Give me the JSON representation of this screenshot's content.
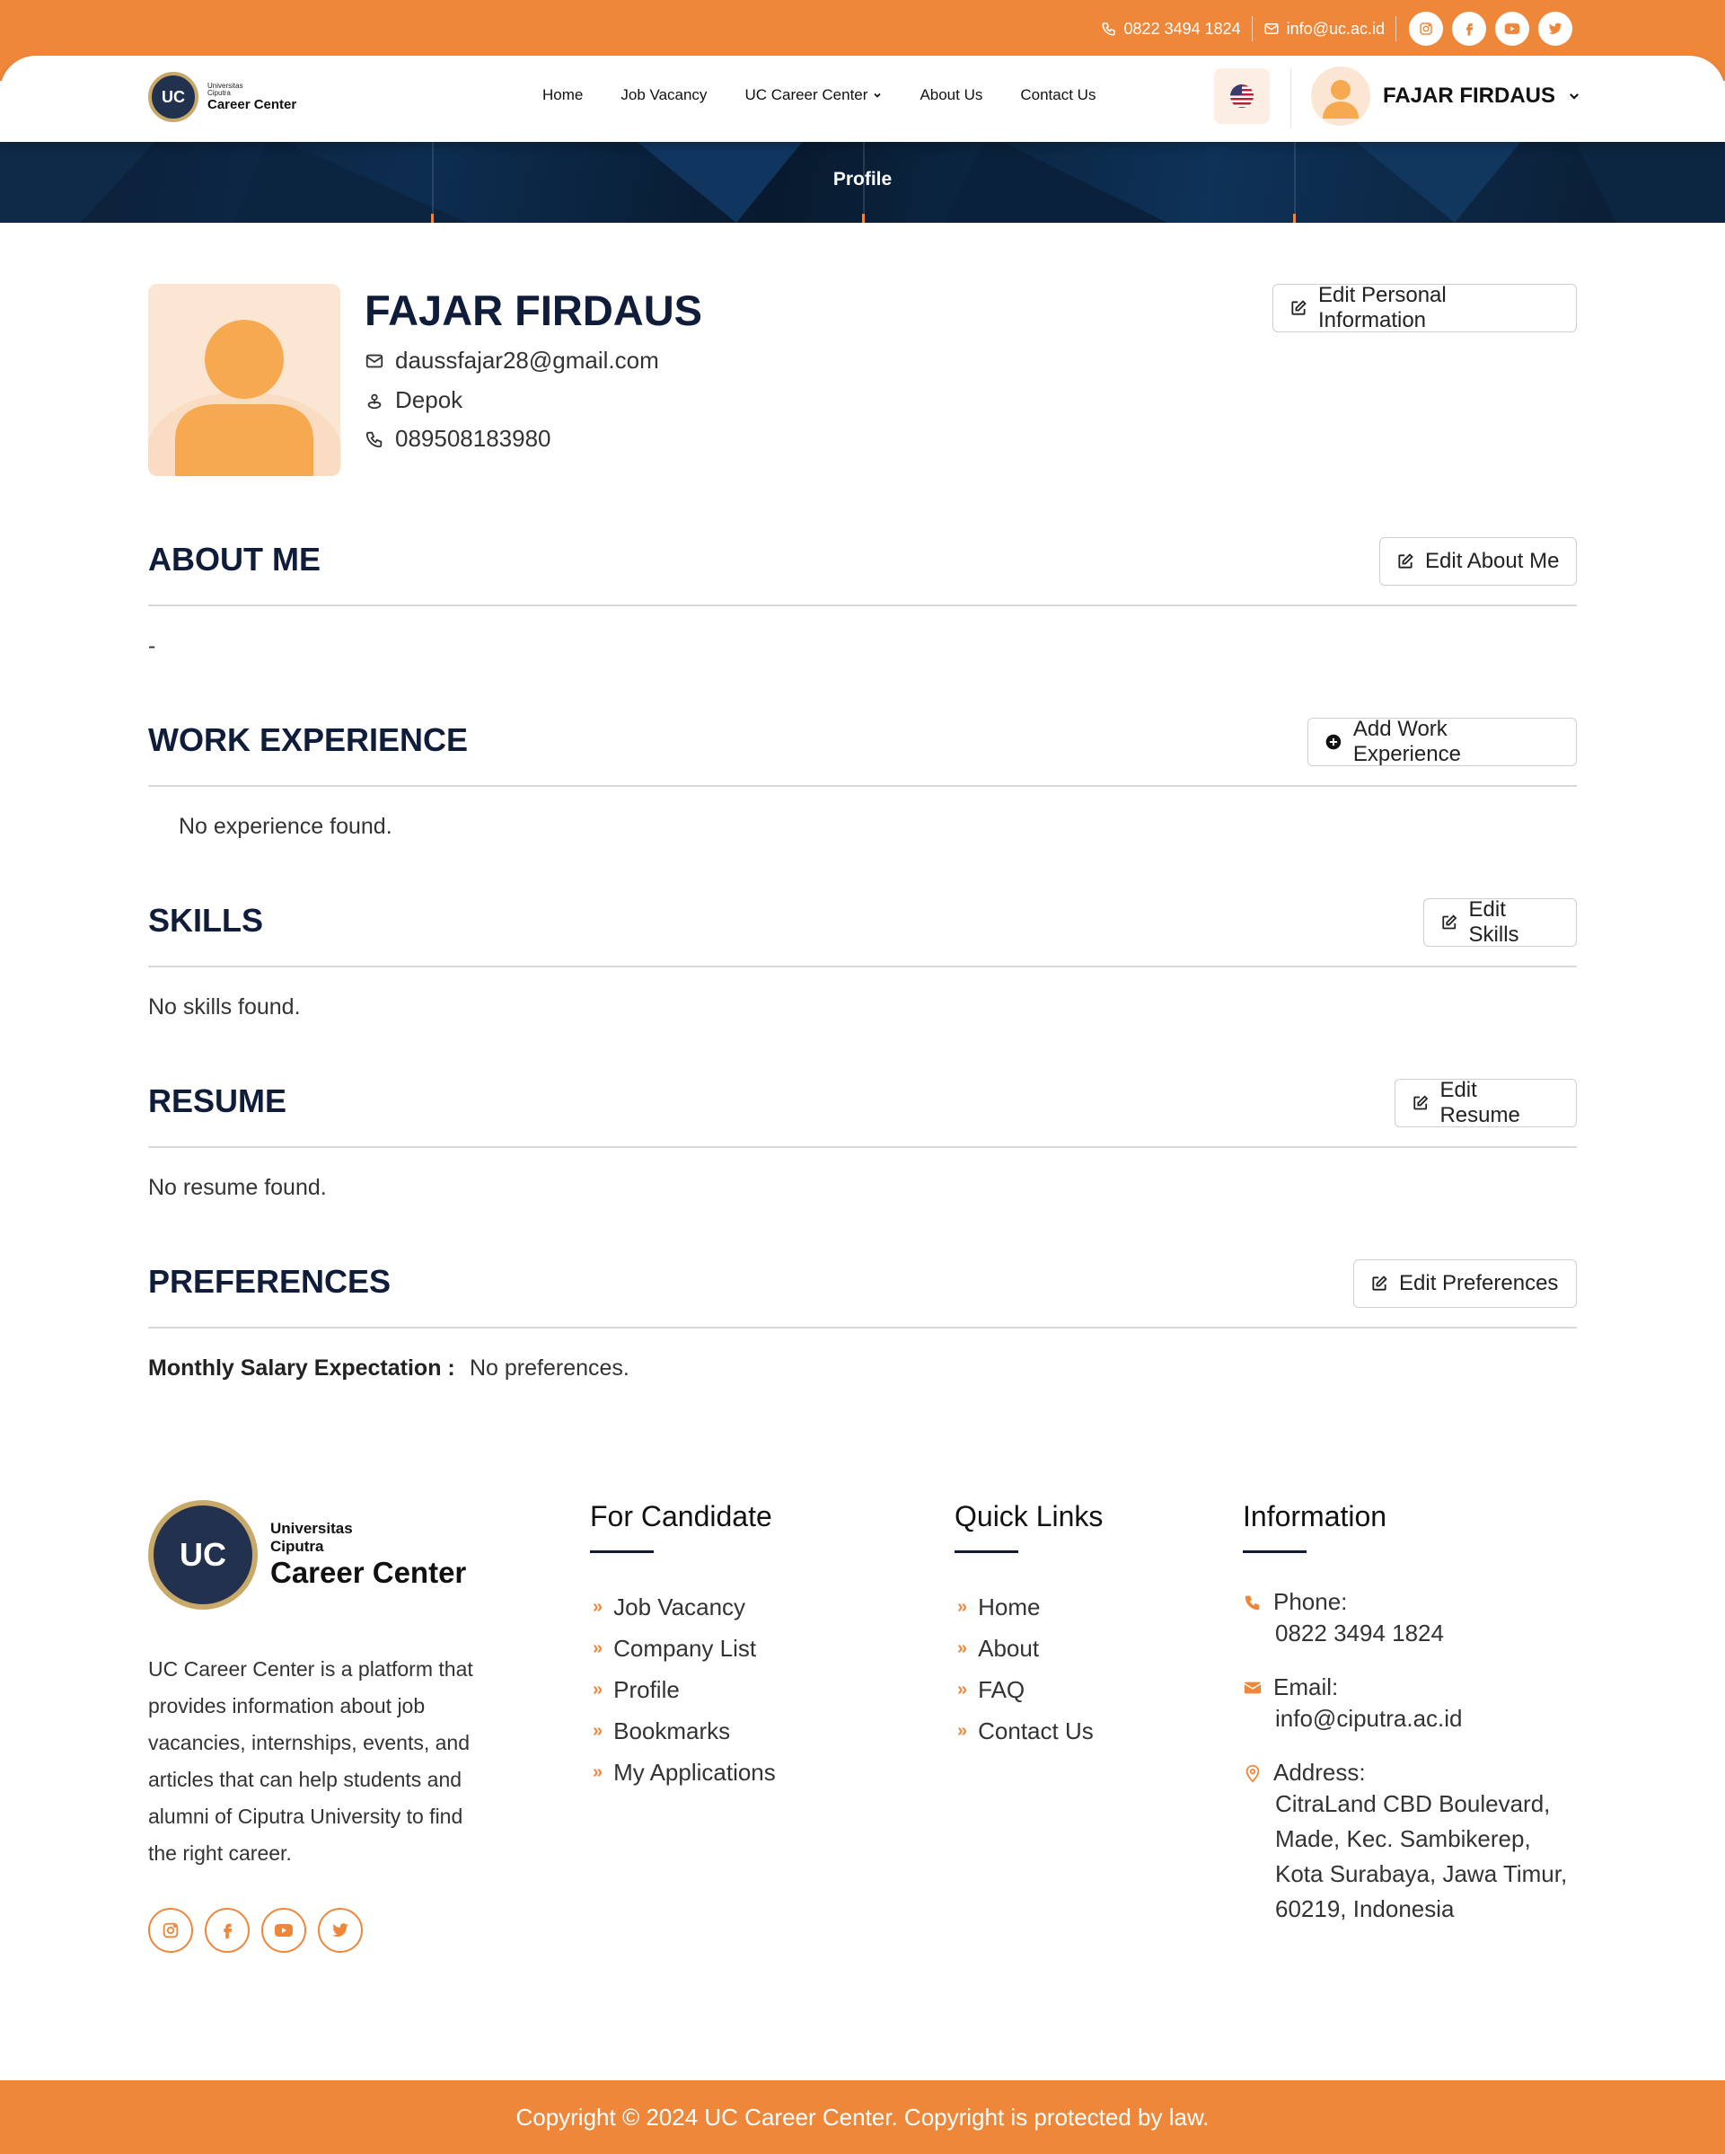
{
  "topbar": {
    "phone": "0822 3494 1824",
    "email": "info@uc.ac.id",
    "social_icons": [
      "instagram-icon",
      "facebook-icon",
      "youtube-icon",
      "twitter-icon"
    ]
  },
  "brand": {
    "logo_line1": "Universitas",
    "logo_line2": "Ciputra",
    "logo_name": "Career Center",
    "logo_mark": "UC"
  },
  "nav": {
    "items": [
      "Home",
      "Job Vacancy",
      "UC Career Center",
      "About Us",
      "Contact Us"
    ],
    "user_name": "FAJAR FIRDAUS"
  },
  "banner": {
    "title": "Profile"
  },
  "profile": {
    "name": "FAJAR FIRDAUS",
    "email": "daussfajar28@gmail.com",
    "location": "Depok",
    "phone": "089508183980",
    "edit_button": "Edit Personal Information"
  },
  "sections": {
    "about": {
      "title": "ABOUT ME",
      "button": "Edit About Me",
      "content": "-"
    },
    "work": {
      "title": "WORK EXPERIENCE",
      "button": "Add Work Experience",
      "content": "No experience found."
    },
    "skills": {
      "title": "SKILLS",
      "button": "Edit Skills",
      "content": "No skills found."
    },
    "resume": {
      "title": "RESUME",
      "button": "Edit Resume",
      "content": "No resume found."
    },
    "preferences": {
      "title": "PREFERENCES",
      "button": "Edit Preferences",
      "salary_label": "Monthly Salary Expectation :",
      "salary_value": "No preferences."
    }
  },
  "footer": {
    "logo_line1": "Universitas",
    "logo_line2": "Ciputra",
    "logo_name": "Career Center",
    "description": "UC Career Center is a platform that provides information about job vacancies, internships, events, and articles that can help students and alumni of Ciputra University to find the right career.",
    "for_candidate": {
      "title": "For Candidate",
      "items": [
        "Job Vacancy",
        "Company List",
        "Profile",
        "Bookmarks",
        "My Applications"
      ]
    },
    "quick_links": {
      "title": "Quick Links",
      "items": [
        "Home",
        "About",
        "FAQ",
        "Contact Us"
      ]
    },
    "information": {
      "title": "Information",
      "phone_label": "Phone:",
      "phone": "0822 3494 1824",
      "email_label": "Email:",
      "email": "info@ciputra.ac.id",
      "address_label": "Address:",
      "address": "CitraLand CBD Boulevard, Made, Kec. Sambikerep, Kota Surabaya, Jawa Timur, 60219, Indonesia"
    },
    "copyright": "Copyright © 2024 UC Career Center. Copyright is protected by law."
  },
  "colors": {
    "accent": "#ef873a",
    "navy": "#0f1d3a"
  }
}
